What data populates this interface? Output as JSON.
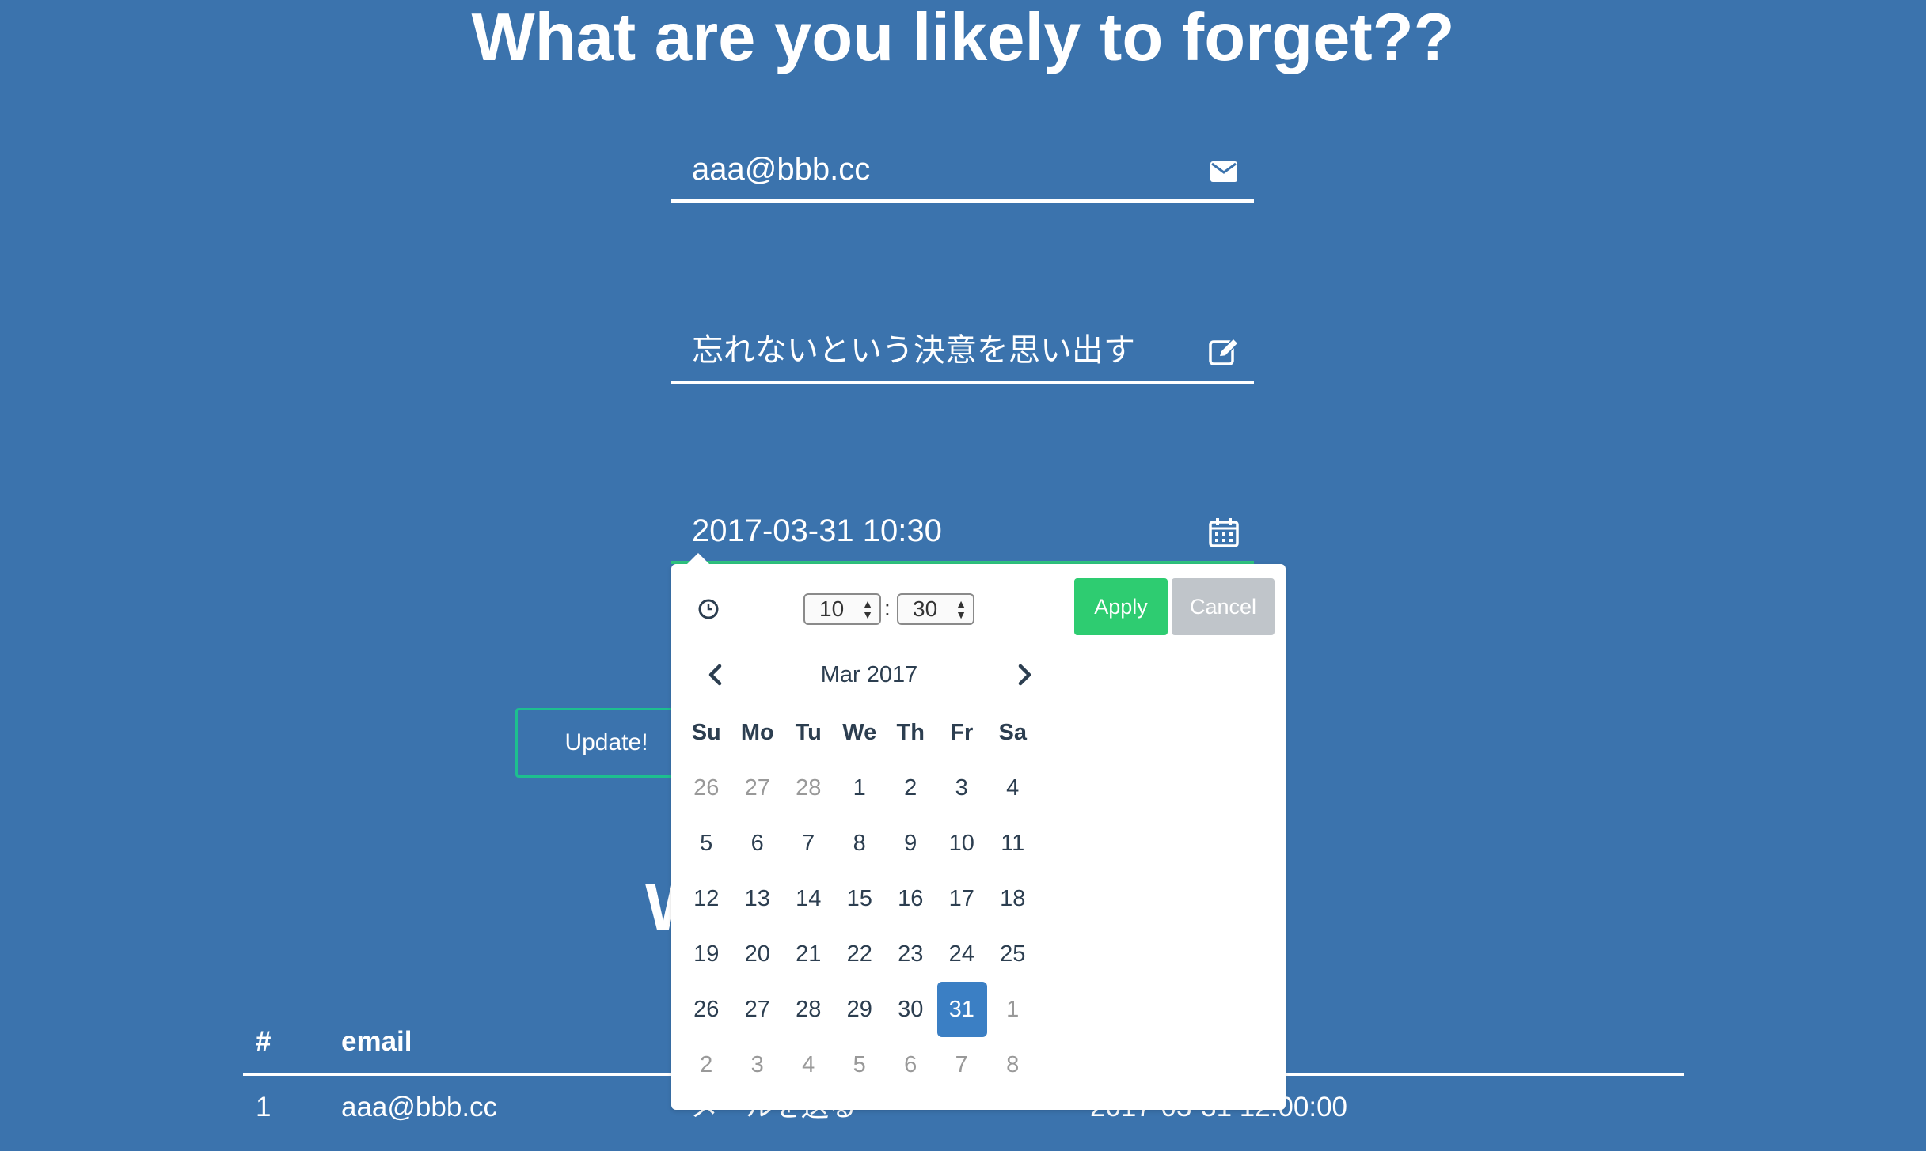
{
  "title": "What are you likely to forget??",
  "form": {
    "email_value": "aaa@bbb.cc",
    "memo_value": "忘れないという決意を思い出す",
    "datetime_value": "2017-03-31 10:30"
  },
  "update_label": "Update!",
  "hidden_heading_fragment": "W",
  "table": {
    "headers": [
      "#",
      "email"
    ],
    "row": {
      "index": "1",
      "email": "aaa@bbb.cc",
      "memo_fragment": "メールを送る",
      "datetime_fragment": "2017-03-31 12:00:00"
    }
  },
  "picker": {
    "hour": "10",
    "minute": "30",
    "time_separator": ":",
    "apply_label": "Apply",
    "cancel_label": "Cancel",
    "month_label": "Mar 2017",
    "weekdays": [
      "Su",
      "Mo",
      "Tu",
      "We",
      "Th",
      "Fr",
      "Sa"
    ],
    "weeks": [
      [
        "26",
        "27",
        "28",
        "1",
        "2",
        "3",
        "4"
      ],
      [
        "5",
        "6",
        "7",
        "8",
        "9",
        "10",
        "11"
      ],
      [
        "12",
        "13",
        "14",
        "15",
        "16",
        "17",
        "18"
      ],
      [
        "19",
        "20",
        "21",
        "22",
        "23",
        "24",
        "25"
      ],
      [
        "26",
        "27",
        "28",
        "29",
        "30",
        "31",
        "1"
      ],
      [
        "2",
        "3",
        "4",
        "5",
        "6",
        "7",
        "8"
      ]
    ],
    "selected_day": "31",
    "colors": {
      "apply": "#2ecc71",
      "cancel": "#c0c5ca",
      "selected": "#3b7fc4"
    }
  },
  "icons": {
    "email_field": "envelope-icon",
    "memo_field": "edit-icon",
    "datetime_field": "calendar-icon",
    "time_row": "clock-icon",
    "prev": "chevron-left-icon",
    "next": "chevron-right-icon"
  },
  "colors": {
    "background": "#3b73ad",
    "update_border": "#1dbf8f"
  }
}
